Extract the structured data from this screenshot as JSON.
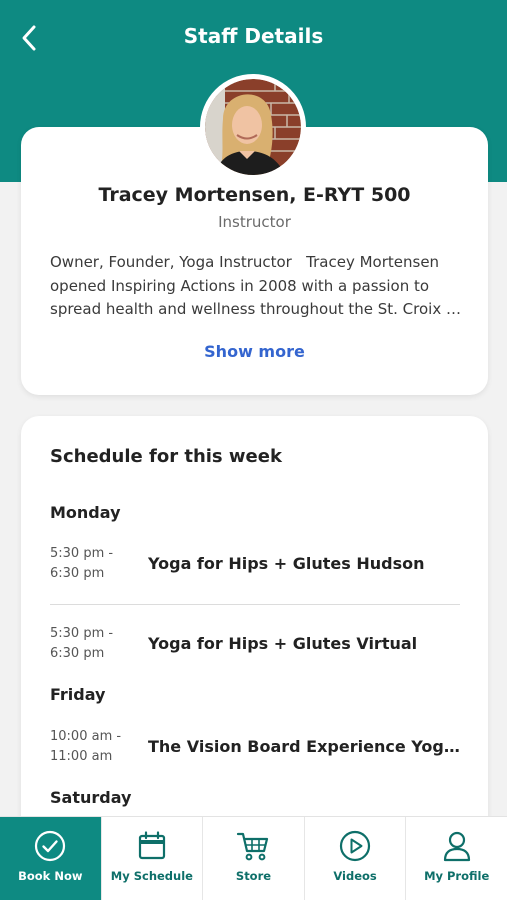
{
  "header": {
    "title": "Staff Details",
    "back_icon": "chevron-left-icon"
  },
  "profile": {
    "name": "Tracey Mortensen, E-RYT 500",
    "role": "Instructor",
    "bio": "Owner, Founder, Yoga Instructor   Tracey Mortensen opened Inspiring Actions in 2008 with a passion to spread health and wellness throughout the St. Croix Valley.",
    "show_more": "Show more"
  },
  "schedule": {
    "title": "Schedule for this week",
    "days": [
      {
        "day": "Monday",
        "classes": [
          {
            "time_start": "5:30 pm -",
            "time_end": "6:30 pm",
            "name": "Yoga for Hips + Glutes Hudson"
          },
          {
            "time_start": "5:30 pm -",
            "time_end": "6:30 pm",
            "name": "Yoga for Hips + Glutes Virtual"
          }
        ]
      },
      {
        "day": "Friday",
        "classes": [
          {
            "time_start": "10:00 am -",
            "time_end": "11:00 am",
            "name": "The Vision Board Experience Yoga Workshop"
          }
        ]
      },
      {
        "day": "Saturday",
        "classes": []
      }
    ]
  },
  "tabs": [
    {
      "label": "Book Now",
      "icon": "check-circle-icon",
      "active": true
    },
    {
      "label": "My Schedule",
      "icon": "calendar-icon",
      "active": false
    },
    {
      "label": "Store",
      "icon": "cart-icon",
      "active": false
    },
    {
      "label": "Videos",
      "icon": "play-circle-icon",
      "active": false
    },
    {
      "label": "My Profile",
      "icon": "user-icon",
      "active": false
    }
  ],
  "colors": {
    "brand": "#0e8a82",
    "link": "#3465cf",
    "tab_text": "#0e6f69"
  }
}
